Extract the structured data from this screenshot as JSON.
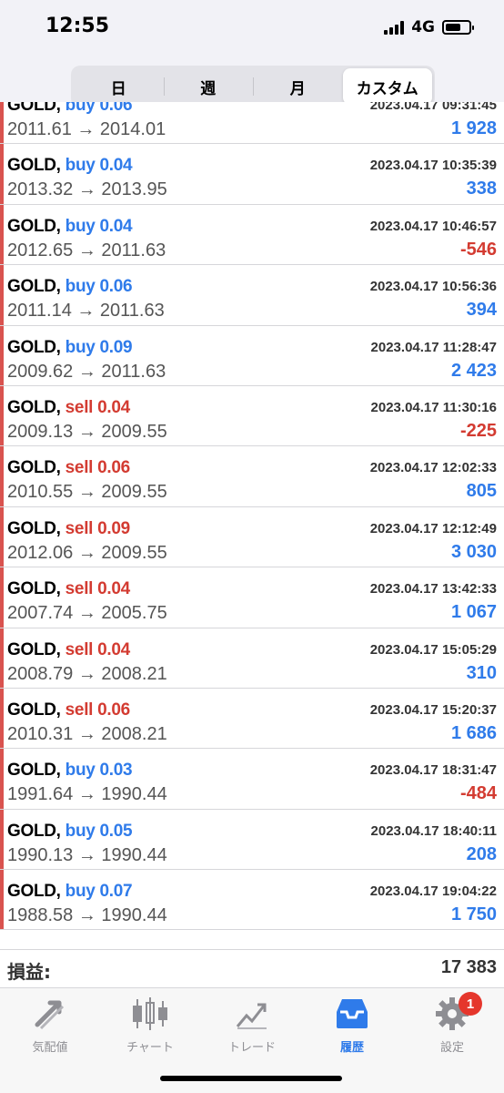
{
  "status_bar": {
    "time": "12:55",
    "network": "4G"
  },
  "segments": [
    {
      "label": "日",
      "active": false
    },
    {
      "label": "週",
      "active": false
    },
    {
      "label": "月",
      "active": false
    },
    {
      "label": "カスタム",
      "active": true
    }
  ],
  "trades": [
    {
      "symbol": "GOLD,",
      "side": "buy",
      "volume": "0.06",
      "side_volume": "buy 0.06",
      "prices": "2011.61 → 2014.01",
      "datetime": "2023.04.17 09:31:45",
      "profit": "1 928",
      "profit_sign": "pos"
    },
    {
      "symbol": "GOLD,",
      "side": "buy",
      "volume": "0.04",
      "side_volume": "buy 0.04",
      "prices": "2013.32 → 2013.95",
      "datetime": "2023.04.17 10:35:39",
      "profit": "338",
      "profit_sign": "pos"
    },
    {
      "symbol": "GOLD,",
      "side": "buy",
      "volume": "0.04",
      "side_volume": "buy 0.04",
      "prices": "2012.65 → 2011.63",
      "datetime": "2023.04.17 10:46:57",
      "profit": "-546",
      "profit_sign": "neg"
    },
    {
      "symbol": "GOLD,",
      "side": "buy",
      "volume": "0.06",
      "side_volume": "buy 0.06",
      "prices": "2011.14 → 2011.63",
      "datetime": "2023.04.17 10:56:36",
      "profit": "394",
      "profit_sign": "pos"
    },
    {
      "symbol": "GOLD,",
      "side": "buy",
      "volume": "0.09",
      "side_volume": "buy 0.09",
      "prices": "2009.62 → 2011.63",
      "datetime": "2023.04.17 11:28:47",
      "profit": "2 423",
      "profit_sign": "pos"
    },
    {
      "symbol": "GOLD,",
      "side": "sell",
      "volume": "0.04",
      "side_volume": "sell 0.04",
      "prices": "2009.13 → 2009.55",
      "datetime": "2023.04.17 11:30:16",
      "profit": "-225",
      "profit_sign": "neg"
    },
    {
      "symbol": "GOLD,",
      "side": "sell",
      "volume": "0.06",
      "side_volume": "sell 0.06",
      "prices": "2010.55 → 2009.55",
      "datetime": "2023.04.17 12:02:33",
      "profit": "805",
      "profit_sign": "pos"
    },
    {
      "symbol": "GOLD,",
      "side": "sell",
      "volume": "0.09",
      "side_volume": "sell 0.09",
      "prices": "2012.06 → 2009.55",
      "datetime": "2023.04.17 12:12:49",
      "profit": "3 030",
      "profit_sign": "pos"
    },
    {
      "symbol": "GOLD,",
      "side": "sell",
      "volume": "0.04",
      "side_volume": "sell 0.04",
      "prices": "2007.74 → 2005.75",
      "datetime": "2023.04.17 13:42:33",
      "profit": "1 067",
      "profit_sign": "pos"
    },
    {
      "symbol": "GOLD,",
      "side": "sell",
      "volume": "0.04",
      "side_volume": "sell 0.04",
      "prices": "2008.79 → 2008.21",
      "datetime": "2023.04.17 15:05:29",
      "profit": "310",
      "profit_sign": "pos"
    },
    {
      "symbol": "GOLD,",
      "side": "sell",
      "volume": "0.06",
      "side_volume": "sell 0.06",
      "prices": "2010.31 → 2008.21",
      "datetime": "2023.04.17 15:20:37",
      "profit": "1 686",
      "profit_sign": "pos"
    },
    {
      "symbol": "GOLD,",
      "side": "buy",
      "volume": "0.03",
      "side_volume": "buy 0.03",
      "prices": "1991.64 → 1990.44",
      "datetime": "2023.04.17 18:31:47",
      "profit": "-484",
      "profit_sign": "neg"
    },
    {
      "symbol": "GOLD,",
      "side": "buy",
      "volume": "0.05",
      "side_volume": "buy 0.05",
      "prices": "1990.13 → 1990.44",
      "datetime": "2023.04.17 18:40:11",
      "profit": "208",
      "profit_sign": "pos"
    },
    {
      "symbol": "GOLD,",
      "side": "buy",
      "volume": "0.07",
      "side_volume": "buy 0.07",
      "prices": "1988.58 → 1990.44",
      "datetime": "2023.04.17 19:04:22",
      "profit": "1 750",
      "profit_sign": "pos"
    }
  ],
  "summary": {
    "label": "損益:",
    "value": "17 383"
  },
  "tabbar": {
    "tabs": [
      {
        "label": "気配値",
        "icon": "quotes-arrows-icon",
        "active": false
      },
      {
        "label": "チャート",
        "icon": "candlestick-chart-icon",
        "active": false
      },
      {
        "label": "トレード",
        "icon": "trade-line-chart-icon",
        "active": false
      },
      {
        "label": "履歴",
        "icon": "history-tray-icon",
        "active": true
      },
      {
        "label": "設定",
        "icon": "gear-icon",
        "active": false,
        "badge": "1"
      }
    ]
  },
  "colors": {
    "buy": "#2f7bea",
    "sell": "#d33b31",
    "accent": "#2f7bea",
    "badge": "#e5362c"
  }
}
